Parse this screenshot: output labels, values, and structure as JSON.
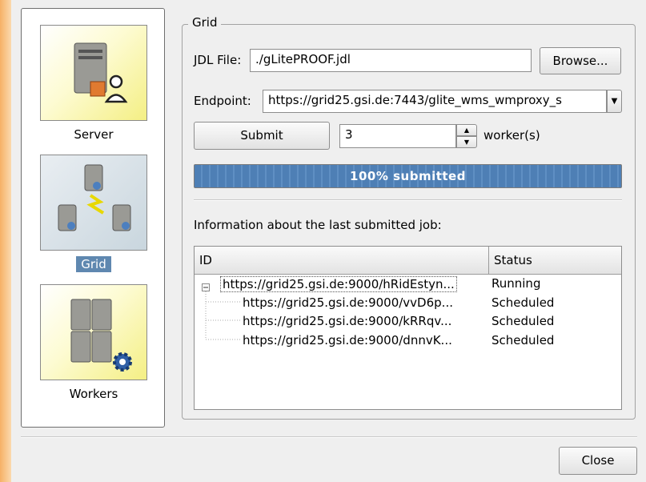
{
  "nav": {
    "items": [
      {
        "label": "Server",
        "icon": "server-user-icon",
        "selected": false
      },
      {
        "label": "Grid",
        "icon": "grid-servers-icon",
        "selected": true
      },
      {
        "label": "Workers",
        "icon": "workers-gear-icon",
        "selected": false
      }
    ]
  },
  "grid": {
    "group_title": "Grid",
    "jdl_label": "JDL File:",
    "jdl_value": "./gLitePROOF.jdl",
    "browse_label": "Browse...",
    "endpoint_label": "Endpoint:",
    "endpoint_value": "https://grid25.gsi.de:7443/glite_wms_wmproxy_s",
    "submit_label": "Submit",
    "workers_value": "3",
    "workers_suffix": "worker(s)",
    "progress_text": "100% submitted",
    "progress_fraction": 1.0,
    "info_label": "Information about the last submitted job:",
    "columns": [
      "ID",
      "Status"
    ],
    "parent": {
      "id": "https://grid25.gsi.de:9000/hRidEstyn...",
      "status": "Running"
    },
    "children": [
      {
        "id": "https://grid25.gsi.de:9000/vvD6p...",
        "status": "Scheduled"
      },
      {
        "id": "https://grid25.gsi.de:9000/kRRqv...",
        "status": "Scheduled"
      },
      {
        "id": "https://grid25.gsi.de:9000/dnnvK...",
        "status": "Scheduled"
      }
    ]
  },
  "footer": {
    "close_label": "Close"
  },
  "colors": {
    "accent": "#5f88b0",
    "progress": "#4e7fb5",
    "side_strip": "#f6b166"
  }
}
